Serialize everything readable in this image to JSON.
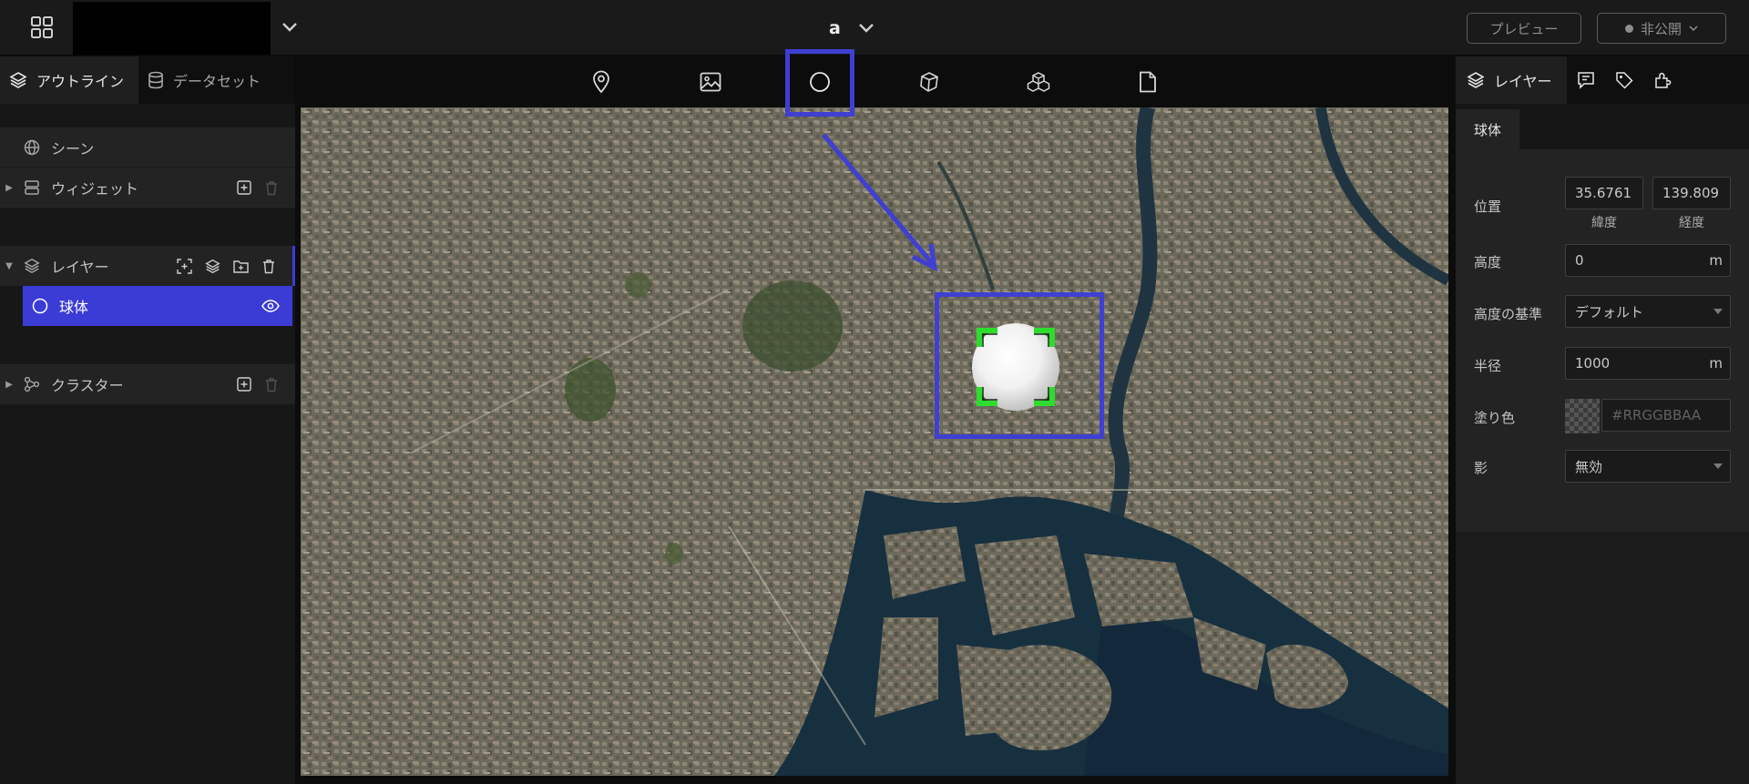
{
  "topbar": {
    "project_title": "a",
    "preview_label": "プレビュー",
    "publish_label": "非公開"
  },
  "left_panel": {
    "tabs": [
      {
        "label": "アウトライン",
        "icon": "layers-icon",
        "active": true
      },
      {
        "label": "データセット",
        "icon": "database-icon",
        "active": false
      }
    ],
    "tree": {
      "scene": "シーン",
      "widgets": "ウィジェット",
      "layers": "レイヤー",
      "layer_items": [
        {
          "label": "球体",
          "icon": "circle-icon",
          "selected": true
        }
      ],
      "clusters": "クラスター"
    }
  },
  "toolbar": {
    "tools": [
      "map-pin-icon",
      "image-icon",
      "sphere-icon",
      "box-icon",
      "model-3d-icon",
      "file-icon"
    ],
    "highlighted_tool": "sphere-icon"
  },
  "right_panel": {
    "tabs": [
      {
        "label": "レイヤー",
        "icon": "layers-icon",
        "active": true
      },
      {
        "label": "",
        "icon": "infobox-icon",
        "active": false
      },
      {
        "label": "",
        "icon": "tag-icon",
        "active": false
      },
      {
        "label": "",
        "icon": "plugin-icon",
        "active": false
      }
    ],
    "subtab": "球体",
    "properties": {
      "position_label": "位置",
      "latitude_value": "35.6761",
      "latitude_caption": "緯度",
      "longitude_value": "139.809",
      "longitude_caption": "経度",
      "height_label": "高度",
      "height_value": "0",
      "height_unit": "m",
      "height_ref_label": "高度の基準",
      "height_ref_value": "デフォルト",
      "radius_label": "半径",
      "radius_value": "1000",
      "radius_unit": "m",
      "fill_label": "塗り色",
      "fill_placeholder": "#RRGGBBAA",
      "shadow_label": "影",
      "shadow_value": "無効"
    }
  },
  "colors": {
    "accent": "#3b3bd6",
    "annotation": "#3f3fd2",
    "selection_handles": "#2ddc2d",
    "background": "#0c0c0c",
    "panel": "#1b1b1b"
  }
}
